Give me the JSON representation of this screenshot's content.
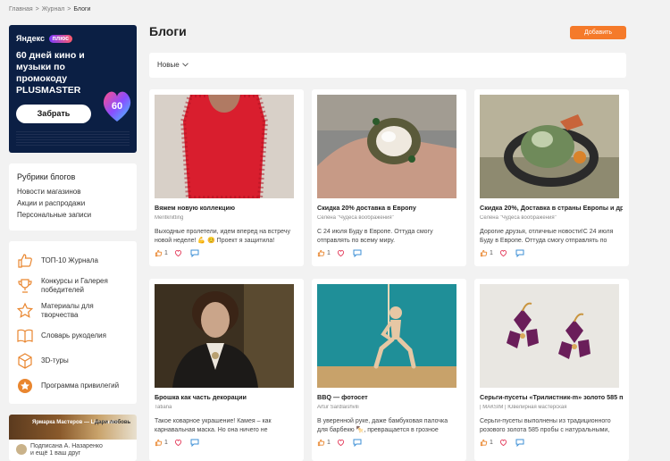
{
  "breadcrumb": [
    "Главная",
    "Журнал",
    "Блоги"
  ],
  "ad": {
    "brand": "Яндекс",
    "plus": "плюс",
    "text": "60 дней кино и музыки по промокоду PLUSMASTER",
    "badge": "60",
    "button": "Забрать"
  },
  "rubrics": {
    "title": "Рубрики блогов",
    "items": [
      "Новости магазинов",
      "Акции и распродажи",
      "Персональные записи"
    ]
  },
  "menu": [
    {
      "label": "ТОП-10 Журнала",
      "icon": "thumbs-up-icon"
    },
    {
      "label": "Конкурсы и Галерея победителей",
      "icon": "trophy-icon"
    },
    {
      "label": "Материалы для творчества",
      "icon": "star-icon"
    },
    {
      "label": "Словарь рукоделия",
      "icon": "book-icon"
    },
    {
      "label": "3D-туры",
      "icon": "cube-icon"
    },
    {
      "label": "Программа привилегий",
      "icon": "privilege-badge-icon"
    }
  ],
  "promo": {
    "left": "Ярмарка Мастеров — Livemaster",
    "right": "Дари любовь",
    "line1": "Подписана А. Назаренко",
    "line2": "и ещё 1 ваш друг"
  },
  "page_title": "Блоги",
  "add_button": "Добавить",
  "sort": {
    "selected": "Новые"
  },
  "cards": [
    {
      "title": "Вяжем новую коллекцию",
      "author": "Meritknitting",
      "desc": "Выходные пролетели, идем вперед на встречу новой неделе! 💪 😊 Проект я защитила!",
      "likes": "1",
      "photo": "red-knit"
    },
    {
      "title": "Скидка 20% доставка в Европу",
      "author": "Селена \"Чудеса воображения\"",
      "desc": "С 24 июля Буду в Европе. Оттуда смогу отправлять по всему миру.",
      "likes": "1",
      "photo": "pendant"
    },
    {
      "title": "Скидка 20%, Доставка в страны Европы и др",
      "author": "Селена \"Чудеса воображения\"",
      "desc": "Дорогие друзья, отличные новости!С 24 июля Буду в Европе. Оттуда смогу отправлять по",
      "likes": "1",
      "photo": "ring"
    },
    {
      "title": "Брошка как часть декорации",
      "author": "Tatiana",
      "desc": "Такое коварное украшение! Камея – как карнавальная маска. Но она ничего не",
      "likes": "1",
      "photo": "portrait"
    },
    {
      "title": "BBQ — фотосет",
      "author": "Artur Sardlaishvili",
      "desc": "В уверенной руке, даже бамбуковая палочка для барбекю 🍢, превращается в грозное оружие.",
      "likes": "1",
      "photo": "mannequin"
    },
    {
      "title": "Серьги-пусеты «Трилистник-m» золото 585 п",
      "author": "| МАКSIМ | Ювелирная мастерская",
      "desc": "Серьги-пусеты выполнены из традиционного розового золота 585 пробы с натуральными,",
      "likes": "1",
      "photo": "earrings"
    }
  ],
  "colors": {
    "accent": "#f57a2a",
    "icon_orange": "#e9862f",
    "like_red": "#e4405f",
    "comment_blue": "#3d8fd6"
  }
}
